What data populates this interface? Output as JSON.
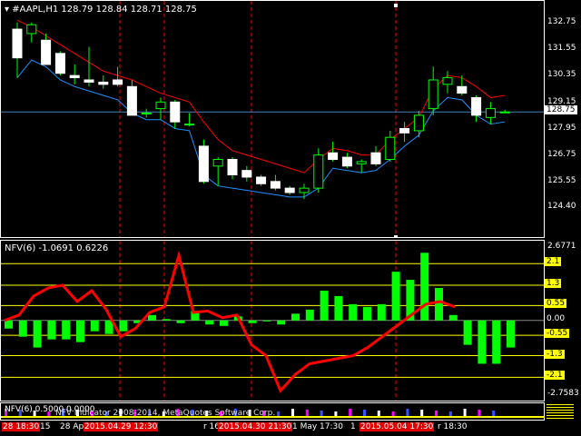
{
  "main": {
    "symbol_label": "#AAPL,H1",
    "ohlc_label": "128.79 128.84 128.71 128.75",
    "price_labels": [
      "132.75",
      "131.55",
      "130.35",
      "129.15",
      "127.95",
      "126.75",
      "125.55",
      "124.40"
    ],
    "current_price": "128.75",
    "current_value": 128.75
  },
  "indicator": {
    "title": "NFV(6) -1.0691 0.6226",
    "level_labels": [
      "2.6771",
      "2.1",
      "1.3",
      "0.55",
      "0.00",
      "-0.55",
      "-1.3",
      "-2.1",
      "-2.7583"
    ]
  },
  "strip": {
    "title": "NFV(6) 0.5000 0.0000"
  },
  "time_labels": [
    {
      "text": "28 18:30",
      "highlight": true
    },
    {
      "text": "15",
      "highlight": false
    },
    {
      "text": "28 Ap",
      "highlight": false
    },
    {
      "text": "2015.04.29 12:30",
      "highlight": true
    },
    {
      "text": "r 16",
      "highlight": false
    },
    {
      "text": "2015.04.30 21:30",
      "highlight": true
    },
    {
      "text": "1 May 17:30",
      "highlight": false
    },
    {
      "text": "1",
      "highlight": false
    },
    {
      "text": "2015.05.04 17:30",
      "highlight": true
    },
    {
      "text": "r 18:30",
      "highlight": false
    }
  ],
  "watermark": "NFV Indicator 2008-2014, MetaQuotes Software Corp.",
  "colors": {
    "background": "#000000",
    "bull": "#ffffff",
    "bear": "#ffffff",
    "wick": "#00ff00",
    "upper_band": "#ff0000",
    "lower_band": "#1e90ff",
    "hist": "#00ff00",
    "nfv_line": "#ff0000",
    "level_line": "#ffff00",
    "separator": "#ff0000",
    "current_line": "#4682b4"
  },
  "chart_data": {
    "type": "candlestick",
    "candles": [
      {
        "o": 132.5,
        "h": 132.8,
        "l": 130.3,
        "c": 131.2
      },
      {
        "o": 132.3,
        "h": 132.8,
        "l": 131.9,
        "c": 132.7
      },
      {
        "o": 132.0,
        "h": 132.3,
        "l": 130.9,
        "c": 130.9
      },
      {
        "o": 131.4,
        "h": 131.5,
        "l": 130.4,
        "c": 130.5
      },
      {
        "o": 130.4,
        "h": 130.9,
        "l": 130.0,
        "c": 130.3
      },
      {
        "o": 130.2,
        "h": 131.7,
        "l": 129.9,
        "c": 130.1
      },
      {
        "o": 130.1,
        "h": 130.4,
        "l": 129.8,
        "c": 130.0
      },
      {
        "o": 130.2,
        "h": 130.8,
        "l": 129.9,
        "c": 130.0
      },
      {
        "o": 129.9,
        "h": 130.2,
        "l": 128.6,
        "c": 128.6
      },
      {
        "o": 128.7,
        "h": 128.9,
        "l": 128.5,
        "c": 128.7
      },
      {
        "o": 128.9,
        "h": 129.4,
        "l": 128.4,
        "c": 129.2
      },
      {
        "o": 129.2,
        "h": 129.3,
        "l": 128.0,
        "c": 128.3
      },
      {
        "o": 128.2,
        "h": 128.7,
        "l": 128.1,
        "c": 128.2
      },
      {
        "o": 127.2,
        "h": 127.5,
        "l": 125.5,
        "c": 125.6
      },
      {
        "o": 126.3,
        "h": 126.7,
        "l": 125.4,
        "c": 126.6
      },
      {
        "o": 126.6,
        "h": 126.7,
        "l": 125.7,
        "c": 125.9
      },
      {
        "o": 126.1,
        "h": 126.3,
        "l": 125.6,
        "c": 125.8
      },
      {
        "o": 125.8,
        "h": 125.9,
        "l": 125.4,
        "c": 125.5
      },
      {
        "o": 125.6,
        "h": 125.9,
        "l": 125.2,
        "c": 125.3
      },
      {
        "o": 125.3,
        "h": 125.4,
        "l": 125.0,
        "c": 125.1
      },
      {
        "o": 125.1,
        "h": 125.5,
        "l": 124.8,
        "c": 125.3
      },
      {
        "o": 125.3,
        "h": 127.1,
        "l": 125.1,
        "c": 126.8
      },
      {
        "o": 126.9,
        "h": 127.4,
        "l": 126.5,
        "c": 126.6
      },
      {
        "o": 126.7,
        "h": 126.9,
        "l": 126.2,
        "c": 126.3
      },
      {
        "o": 126.4,
        "h": 126.6,
        "l": 126.0,
        "c": 126.5
      },
      {
        "o": 126.9,
        "h": 127.2,
        "l": 126.3,
        "c": 126.4
      },
      {
        "o": 126.6,
        "h": 127.9,
        "l": 126.5,
        "c": 127.6
      },
      {
        "o": 128.0,
        "h": 128.3,
        "l": 127.4,
        "c": 127.8
      },
      {
        "o": 127.9,
        "h": 128.8,
        "l": 127.6,
        "c": 128.6
      },
      {
        "o": 128.9,
        "h": 130.8,
        "l": 128.6,
        "c": 130.2
      },
      {
        "o": 130.0,
        "h": 130.6,
        "l": 129.6,
        "c": 130.3
      },
      {
        "o": 129.9,
        "h": 130.4,
        "l": 129.5,
        "c": 129.6
      },
      {
        "o": 129.4,
        "h": 129.5,
        "l": 128.3,
        "c": 128.6
      },
      {
        "o": 128.5,
        "h": 129.2,
        "l": 128.2,
        "c": 128.9
      },
      {
        "o": 128.75,
        "h": 128.84,
        "l": 128.71,
        "c": 128.75
      }
    ],
    "upper_band": [
      132.9,
      132.6,
      132.2,
      131.8,
      131.4,
      131.0,
      130.6,
      130.4,
      130.2,
      129.9,
      129.6,
      129.4,
      129.2,
      128.3,
      127.5,
      127.0,
      126.8,
      126.6,
      126.4,
      126.2,
      126.0,
      126.6,
      127.1,
      127.0,
      126.8,
      126.8,
      127.5,
      128.0,
      128.5,
      129.8,
      130.4,
      130.3,
      129.9,
      129.4,
      129.5
    ],
    "lower_band": [
      130.3,
      131.1,
      130.8,
      130.2,
      129.9,
      129.7,
      129.5,
      129.3,
      128.7,
      128.4,
      128.4,
      128.0,
      127.9,
      125.9,
      125.4,
      125.3,
      125.2,
      125.1,
      125.0,
      124.9,
      124.9,
      125.3,
      126.2,
      126.1,
      126.0,
      126.1,
      126.6,
      127.2,
      127.7,
      128.8,
      129.4,
      129.3,
      128.6,
      128.2,
      128.3
    ],
    "nfv_hist": [
      -0.3,
      -0.6,
      -1.0,
      -0.7,
      -0.7,
      -0.8,
      -0.4,
      -0.5,
      -0.4,
      -0.1,
      0.2,
      0.05,
      -0.1,
      0.35,
      -0.15,
      -0.2,
      0.15,
      -0.1,
      0.0,
      -0.15,
      0.25,
      0.4,
      1.1,
      0.9,
      0.6,
      0.5,
      0.6,
      1.8,
      1.5,
      2.5,
      1.2,
      0.2,
      -0.9,
      -1.6,
      -1.6,
      -1.0
    ],
    "nfv_line": [
      0.0,
      0.2,
      0.9,
      1.2,
      1.3,
      0.7,
      1.1,
      0.4,
      -0.6,
      -0.3,
      0.3,
      0.5,
      2.4,
      0.3,
      0.35,
      0.1,
      0.2,
      -0.9,
      -1.3,
      -2.6,
      -2.0,
      -1.6,
      -1.5,
      -1.4,
      -1.3,
      -1.0,
      -0.6,
      -0.2,
      0.2,
      0.6,
      0.7,
      0.5
    ],
    "levels": [
      2.1,
      1.3,
      0.55,
      0.0,
      -0.55,
      -1.3,
      -2.1
    ],
    "ylim_main": [
      124.4,
      132.75
    ],
    "ylim_indicator": [
      -2.7583,
      2.6771
    ]
  }
}
